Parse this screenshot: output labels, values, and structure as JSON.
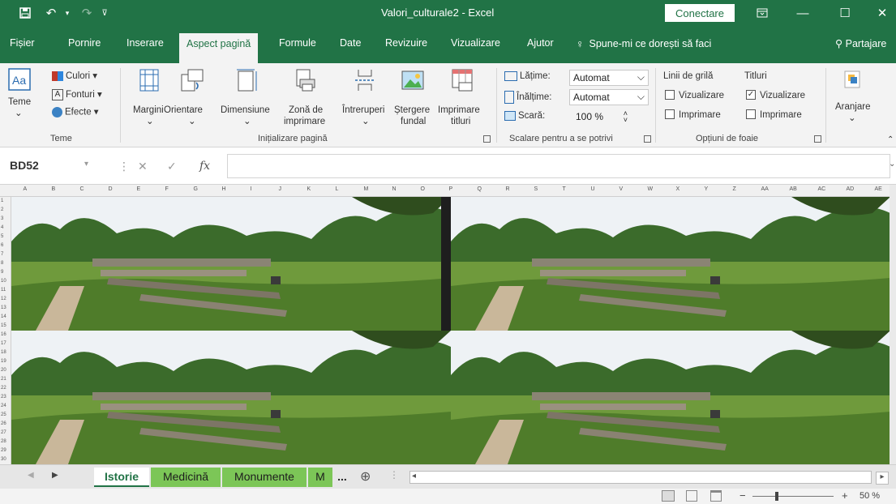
{
  "window": {
    "title": "Valori_culturale2 - Excel",
    "connect_label": "Conectare"
  },
  "tabs": {
    "file": "Fișier",
    "home": "Pornire",
    "insert": "Inserare",
    "page_layout": "Aspect pagină",
    "formulas": "Formule",
    "data": "Date",
    "review": "Revizuire",
    "view": "Vizualizare",
    "help": "Ajutor",
    "tell_me": "Spune-mi ce dorești să faci",
    "share": "Partajare"
  },
  "ribbon": {
    "themes": {
      "themes_label": "Teme",
      "colors_label": "Culori",
      "fonts_label": "Fonturi",
      "effects_label": "Efecte",
      "group_name": "Teme"
    },
    "page_setup": {
      "margins": "Margini",
      "orientation": "Orientare",
      "size": "Dimensiune",
      "print_area_line1": "Zonă de",
      "print_area_line2": "imprimare",
      "breaks": "Întreruperi",
      "background_line1": "Ștergere",
      "background_line2": "fundal",
      "print_titles_line1": "Imprimare",
      "print_titles_line2": "titluri",
      "group_name": "Inițializare pagină"
    },
    "scale": {
      "width_label": "Lățime:",
      "width_value": "Automat",
      "height_label": "Înălțime:",
      "height_value": "Automat",
      "scale_label": "Scară:",
      "scale_value": "100 %",
      "group_name": "Scalare pentru a se potrivi"
    },
    "sheet_options": {
      "gridlines_heading": "Linii de grilă",
      "headings_heading": "Titluri",
      "gridlines_view": "Vizualizare",
      "gridlines_print": "Imprimare",
      "headings_view": "Vizualizare",
      "headings_print": "Imprimare",
      "group_name": "Opțiuni de foaie"
    },
    "arrange": {
      "label": "Aranjare"
    }
  },
  "formula_bar": {
    "name_box": "BD52",
    "fx": "fx"
  },
  "grid": {
    "columns": [
      "A",
      "B",
      "C",
      "D",
      "E",
      "F",
      "G",
      "H",
      "I",
      "J",
      "K",
      "L",
      "M",
      "N",
      "O",
      "P",
      "Q",
      "R",
      "S",
      "T",
      "U",
      "V",
      "W",
      "X",
      "Y",
      "Z",
      "AA",
      "AB",
      "AC",
      "AD",
      "AE"
    ],
    "rows": [
      "1",
      "2",
      "3",
      "4",
      "5",
      "6",
      "7",
      "8",
      "9",
      "10",
      "11",
      "12",
      "13",
      "14",
      "15",
      "16",
      "17",
      "18",
      "19",
      "20",
      "21",
      "22",
      "23",
      "24",
      "25",
      "26",
      "27",
      "28",
      "29",
      "30"
    ]
  },
  "sheets": {
    "tab1": "Istorie",
    "tab2": "Medicină",
    "tab3": "Monumente",
    "tab4": "M",
    "more": "..."
  },
  "status": {
    "zoom": "50 %"
  },
  "colors": {
    "brand": "#217346",
    "sheet_tab_green": "#7cc657"
  }
}
